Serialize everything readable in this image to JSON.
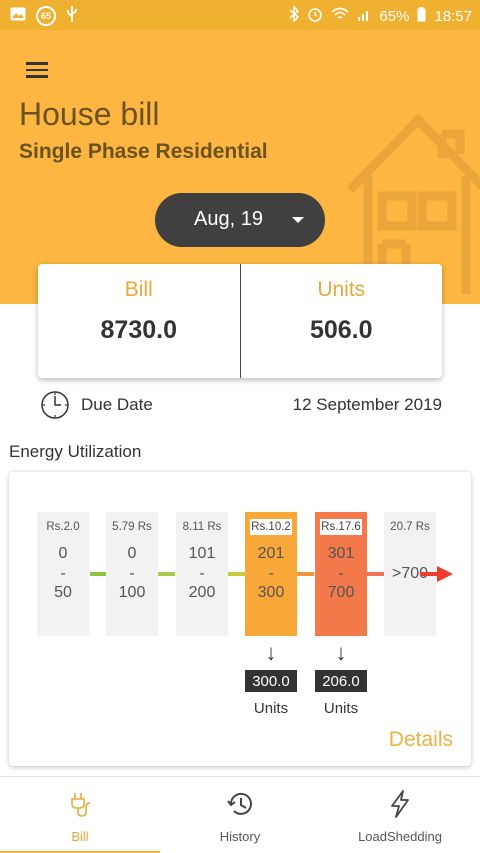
{
  "status_bar": {
    "notif_badge": "65",
    "battery": "65%",
    "time": "18:57"
  },
  "header": {
    "title": "House bill",
    "subtitle": "Single Phase Residential",
    "month": "Aug, 19"
  },
  "summary": {
    "bill_label": "Bill",
    "bill_value": "8730.0",
    "units_label": "Units",
    "units_value": "506.0"
  },
  "due": {
    "label": "Due Date",
    "date": "12 September 2019"
  },
  "energy": {
    "section_title": "Energy Utilization",
    "slabs": [
      {
        "rate": "Rs.2.0",
        "from": "0",
        "sep": "-",
        "to": "50",
        "color": "#f2f2f2",
        "active": false
      },
      {
        "rate": "5.79 Rs",
        "from": "0",
        "sep": "-",
        "to": "100",
        "color": "#f2f2f2",
        "active": false
      },
      {
        "rate": "8.11 Rs",
        "from": "101",
        "sep": "-",
        "to": "200",
        "color": "#f2f2f2",
        "active": false
      },
      {
        "rate": "Rs.10.2",
        "from": "201",
        "sep": "-",
        "to": "300",
        "color": "#f7a839",
        "active": true
      },
      {
        "rate": "Rs.17.6",
        "from": "301",
        "sep": "-",
        "to": "700",
        "color": "#f4794a",
        "active": true
      },
      {
        "rate": "20.7 Rs",
        "range": ">700",
        "color": "#f2f2f2",
        "active": false
      }
    ],
    "connector_colors": [
      "#8cc63f",
      "#a8cc4a",
      "#c8cc3a",
      "#f2953f",
      "#f2735a"
    ],
    "consumed": [
      {
        "units": "300.0",
        "label": "Units"
      },
      {
        "units": "206.0",
        "label": "Units"
      }
    ],
    "details": "Details"
  },
  "nav": {
    "items": [
      {
        "label": "Bill",
        "icon": "plug-icon",
        "active": true
      },
      {
        "label": "History",
        "icon": "history-icon",
        "active": false
      },
      {
        "label": "LoadShedding",
        "icon": "lightning-icon",
        "active": false
      }
    ]
  },
  "colors": {
    "header": "#fcb641",
    "accent": "#e8a93a",
    "pill": "#404040"
  }
}
